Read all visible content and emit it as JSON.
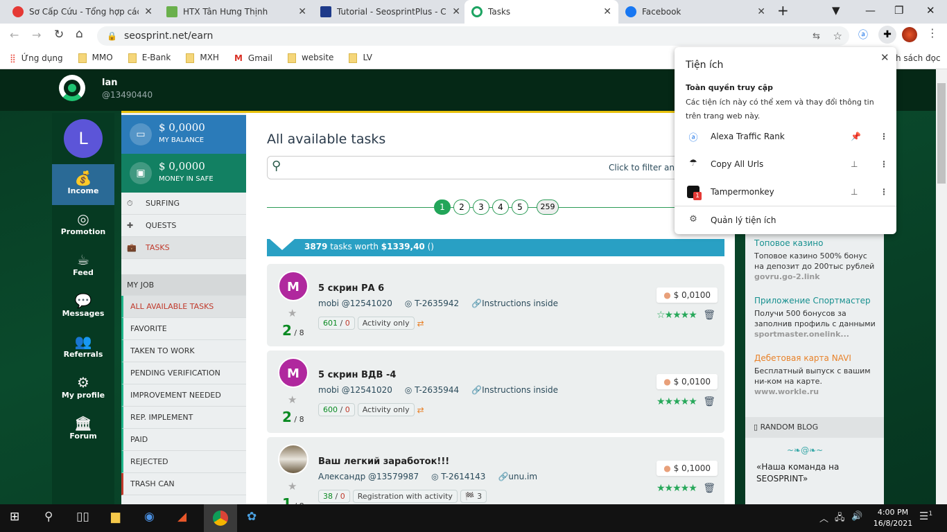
{
  "browser": {
    "tabs": [
      {
        "title": "Sơ Cấp Cứu - Tổng hợp các p",
        "color": "#e53935"
      },
      {
        "title": "HTX Tân Hưng Thịnh",
        "color": "#6ab04c"
      },
      {
        "title": "Tutorial - SeosprintPlus - Chiế",
        "color": "#1e3a8a"
      },
      {
        "title": "Tasks",
        "color": "#1da462"
      },
      {
        "title": "Facebook",
        "color": "#1877f2"
      }
    ],
    "url": "seosprint.net/earn",
    "bookmarks": [
      "Ứng dụng",
      "MMO",
      "E-Bank",
      "MXH",
      "Gmail",
      "website",
      "LV"
    ],
    "reading_list": "h sách đọc"
  },
  "header": {
    "name": "lan",
    "id": "@13490440"
  },
  "avatar_letter": "L",
  "nav": [
    "Income",
    "Promotion",
    "Feed",
    "Messages",
    "Referrals",
    "My profile",
    "Forum"
  ],
  "balance": {
    "value": "$ 0,0000",
    "label": "MY BALANCE"
  },
  "safe": {
    "value": "$ 0,0000",
    "label": "MONEY IN SAFE"
  },
  "menu": [
    "SURFING",
    "QUESTS",
    "TASKS"
  ],
  "myjob": {
    "title": "MY JOB",
    "items": [
      "ALL AVAILABLE TASKS",
      "FAVORITE",
      "TAKEN TO WORK",
      "PENDING VERIFICATION",
      "IMPROVEMENT NEEDED",
      "REP. IMPLEMENT",
      "PAID",
      "REJECTED",
      "TRASH CAN"
    ]
  },
  "main": {
    "title": "All available tasks",
    "filter_placeholder": "Click to filter and",
    "pages": [
      "1",
      "2",
      "3",
      "4",
      "5",
      "259"
    ],
    "summary_count": "3879",
    "summary_mid": " tasks worth ",
    "summary_amount": "$1339,40",
    "summary_end": " ()",
    "tasks": [
      {
        "avatar": "M",
        "title": "5 скрин РА 6",
        "author": "mobi @12541020",
        "id": "T-2635942",
        "link": "Instructions inside",
        "stats_a": "601",
        "stats_b": "0",
        "type": "Activity only",
        "extra": "⇄",
        "price": "$ 0,0100",
        "done": "2",
        "total": "/ 8",
        "stars": "☆★★★★"
      },
      {
        "avatar": "M",
        "title": "5 скрин ВДВ -4",
        "author": "mobi @12541020",
        "id": "T-2635944",
        "link": "Instructions inside",
        "stats_a": "600",
        "stats_b": "0",
        "type": "Activity only",
        "extra": "⇄",
        "price": "$ 0,0100",
        "done": "2",
        "total": "/ 8",
        "stars": "★★★★★"
      },
      {
        "avatar": "",
        "title": "Ваш легкий заработок!!!",
        "author": "Александр @13579987",
        "id": "T-2614143",
        "link": "unu.im",
        "stats_a": "38",
        "stats_b": "0",
        "type": "Registration with activity",
        "extra": "🏁 3",
        "price": "$ 0,1000",
        "done": "1",
        "total": "/ 8",
        "stars": "★★★★★"
      }
    ]
  },
  "ads": [
    {
      "title": "Топовое казино",
      "text": "Топовое казино 500% бонус на депозит до 200тыс рублей",
      "url": "govru.go-2.link",
      "color": "#17908f"
    },
    {
      "title": "Приложение Спортмастер",
      "text": "Получи 500 бонусов за заполнив профиль с данными",
      "url": "sportmaster.onelink...",
      "color": "#17908f"
    },
    {
      "title": "Дебетовая карта NAVI",
      "text": "Бесплатный выпуск с вашим ни-ком на карте.",
      "url": "www.workle.ru",
      "color": "#e8822a"
    }
  ],
  "blog": {
    "title": "RANDOM BLOG",
    "post": "«Наша команда на SEOSPRINT»"
  },
  "extensions_popup": {
    "title": "Tiện ích",
    "section": "Toàn quyền truy cập",
    "desc": "Các tiện ích này có thể xem và thay đổi thông tin trên trang web này.",
    "items": [
      {
        "name": "Alexa Traffic Rank",
        "pinned": true
      },
      {
        "name": "Copy All Urls",
        "pinned": false
      },
      {
        "name": "Tampermonkey",
        "pinned": false,
        "badge": "1"
      }
    ],
    "manage": "Quản lý tiện ích"
  },
  "taskbar": {
    "time": "4:00 PM",
    "date": "16/8/2021",
    "notifications": "1"
  }
}
